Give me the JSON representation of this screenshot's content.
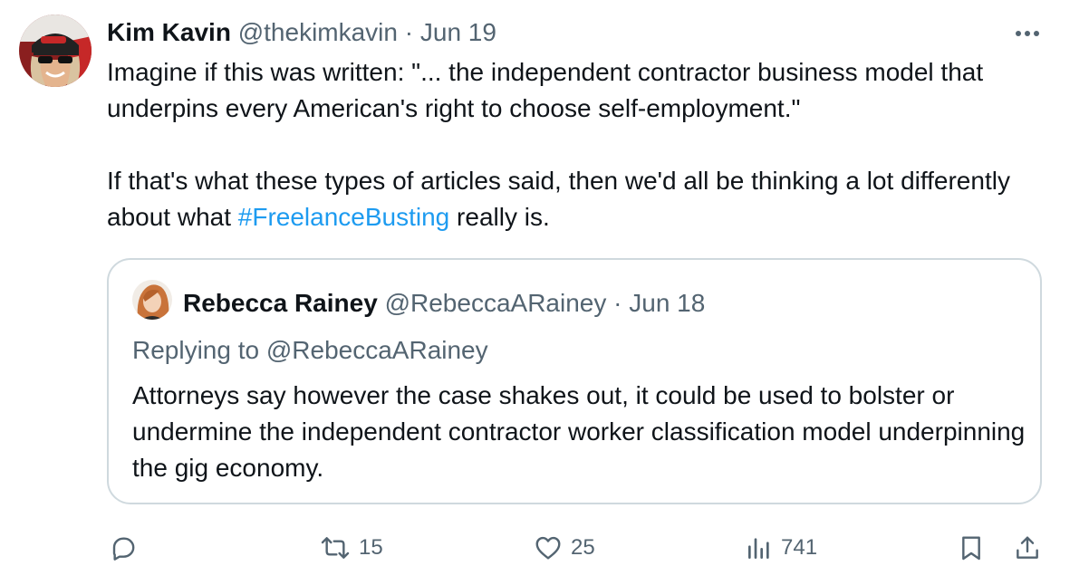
{
  "author": {
    "name": "Kim Kavin",
    "handle": "@thekimkavin",
    "separator": "·",
    "date": "Jun 19"
  },
  "tweet": {
    "line1_prefix": "Imagine if this was written: \"... the independent contractor business model that underpins every American's right to choose self-employment.\"",
    "line2_prefix": "If that's what these types of articles said, then we'd all be thinking a lot differently about what ",
    "hashtag": "#FreelanceBusting",
    "line2_suffix": " really is."
  },
  "quoted": {
    "name": "Rebecca Rainey",
    "handle": "@RebeccaARainey",
    "separator": "·",
    "date": "Jun 18",
    "replying_to": "Replying to @RebeccaARainey",
    "text": "Attorneys say however the case shakes out, it could be used to bolster or undermine the independent contractor worker classification model underpinning the gig economy."
  },
  "actions": {
    "reply_icon": "reply-icon",
    "retweets": "15",
    "retweet_icon": "retweet-icon",
    "likes": "25",
    "like_icon": "heart-icon",
    "views": "741",
    "views_icon": "views-icon",
    "bookmark_icon": "bookmark-icon",
    "share_icon": "share-icon"
  },
  "colors": {
    "text": "#0f1419",
    "secondary": "#536471",
    "link": "#1d9bf0",
    "border": "#cfd9de"
  }
}
